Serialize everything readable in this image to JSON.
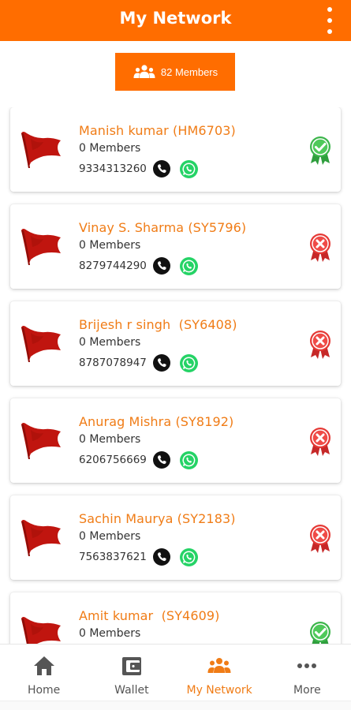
{
  "appbar": {
    "title": "My Network",
    "menu_icon": "more-vert-icon"
  },
  "members_button": {
    "label": "82 Members",
    "icon": "group-icon"
  },
  "colors": {
    "accent": "#ff6d00",
    "name_text": "#f07c16",
    "flag": "#c0150f",
    "active": "#3bb54a",
    "inactive": "#e53935",
    "whatsapp": "#25d366"
  },
  "members": [
    {
      "name": "Manish kumar (HM6703)",
      "count": "0 Members",
      "phone": "9334313260",
      "status": "active"
    },
    {
      "name": "Vinay S. Sharma (SY5796)",
      "count": "0 Members",
      "phone": "8279744290",
      "status": "inactive"
    },
    {
      "name": "Brijesh r singh  (SY6408)",
      "count": "0 Members",
      "phone": "8787078947",
      "status": "inactive"
    },
    {
      "name": "Anurag Mishra (SY8192)",
      "count": "0 Members",
      "phone": "6206756669",
      "status": "inactive"
    },
    {
      "name": "Sachin Maurya (SY2183)",
      "count": "0 Members",
      "phone": "7563837621",
      "status": "inactive"
    },
    {
      "name": "Amit kumar  (SY4609)",
      "count": "0 Members",
      "phone": "",
      "status": "active"
    }
  ],
  "bottom_nav": [
    {
      "label": "Home",
      "icon": "home-icon",
      "active": false
    },
    {
      "label": "Wallet",
      "icon": "wallet-icon",
      "active": false
    },
    {
      "label": "My Network",
      "icon": "group-icon",
      "active": true
    },
    {
      "label": "More",
      "icon": "more-horiz-icon",
      "active": false
    }
  ]
}
